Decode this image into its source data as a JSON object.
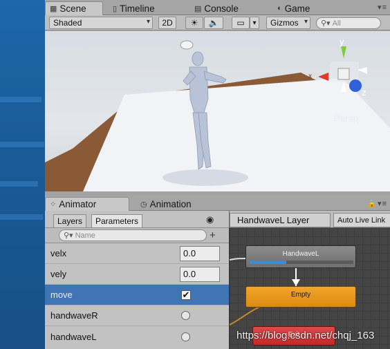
{
  "scene_tabs": [
    {
      "label": "Scene",
      "icon": "scene-icon"
    },
    {
      "label": "Timeline",
      "icon": "timeline-icon"
    },
    {
      "label": "Console",
      "icon": "console-icon"
    },
    {
      "label": "Game",
      "icon": "game-icon"
    }
  ],
  "scene_toolbar": {
    "shading_mode": "Shaded",
    "mode_2d": "2D",
    "gizmos": "Gizmos",
    "search_placeholder": "All"
  },
  "gizmo": {
    "axis_y": "y",
    "axis_x": "x",
    "axis_z": "z",
    "projection": "Persp"
  },
  "animator_tabs": [
    {
      "label": "Animator",
      "icon": "animator-icon"
    },
    {
      "label": "Animation",
      "icon": "animation-icon"
    }
  ],
  "animator": {
    "subtabs": {
      "layers": "Layers",
      "parameters": "Parameters"
    },
    "search_placeholder": "Name",
    "add_button": "+",
    "layer_title": "HandwaveL Layer",
    "auto_live_link": "Auto Live Link"
  },
  "parameters": [
    {
      "name": "velx",
      "type": "float",
      "value": "0.0"
    },
    {
      "name": "vely",
      "type": "float",
      "value": "0.0"
    },
    {
      "name": "move",
      "type": "bool",
      "checked": true,
      "selected": true
    },
    {
      "name": "handwaveR",
      "type": "trigger"
    },
    {
      "name": "handwaveL",
      "type": "trigger"
    }
  ],
  "graph": {
    "state_handwave": "HandwaveL",
    "state_handwave_progress": 0.35,
    "state_empty": "Empty",
    "state_partial": "Exit"
  },
  "watermark": "https://blog.csdn.net/chqj_163",
  "colors": {
    "selected_row": "#3f74b5",
    "default_state": "#e89e1e",
    "progress_bar": "#3d8bd6",
    "exit_state": "#d23636"
  }
}
